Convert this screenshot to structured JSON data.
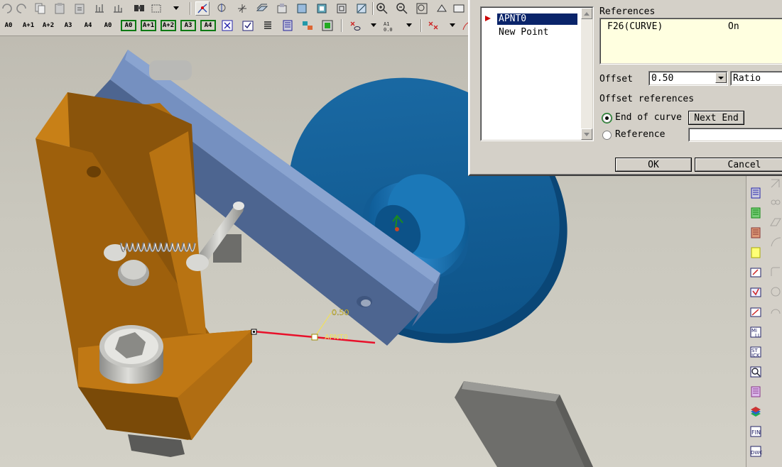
{
  "top_toolbar": {
    "view_mode_labels": [
      "A0",
      "A+1",
      "A+2",
      "A3",
      "A4",
      "A0",
      "A0",
      "A+1",
      "A+2",
      "A3",
      "A4"
    ]
  },
  "dialog": {
    "point_list": [
      {
        "label": "APNT0",
        "selected": true
      },
      {
        "label": "New Point",
        "selected": false
      }
    ],
    "references_label": "References",
    "references_rows": [
      {
        "name": "F26(CURVE)",
        "state": "On"
      }
    ],
    "offset_label": "Offset",
    "offset_value": "0.50",
    "offset_type_value": "Ratio",
    "offset_references_label": "Offset references",
    "end_of_curve_label": "End of curve",
    "next_end_label": "Next End",
    "reference_label": "Reference",
    "reference_value": "",
    "ok_label": "OK",
    "cancel_label": "Cancel",
    "selected_option": "End of curve"
  },
  "viewport": {
    "point_ratio_tag": "0.50",
    "point_name_tag": "APNT0"
  },
  "colors": {
    "selection_blue": "#0a246a",
    "curve_red": "#e8102a",
    "tag_yellow": "#f0e060",
    "brown_part": "#a0600a",
    "steel_blue_part": "#5a7ab0",
    "disk_blue": "#1a6aa8"
  }
}
